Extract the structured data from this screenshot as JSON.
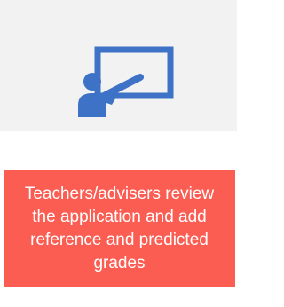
{
  "step": {
    "icon": "teacher-at-board-icon",
    "caption": "Teachers/advisers review\nthe application and add\nreference and predicted\ngrades"
  },
  "colors": {
    "icon_card_background": "#f2f2f2",
    "icon_blue": "#3d72c6",
    "caption_background": "#fb5d52",
    "caption_text": "#ffffff"
  }
}
